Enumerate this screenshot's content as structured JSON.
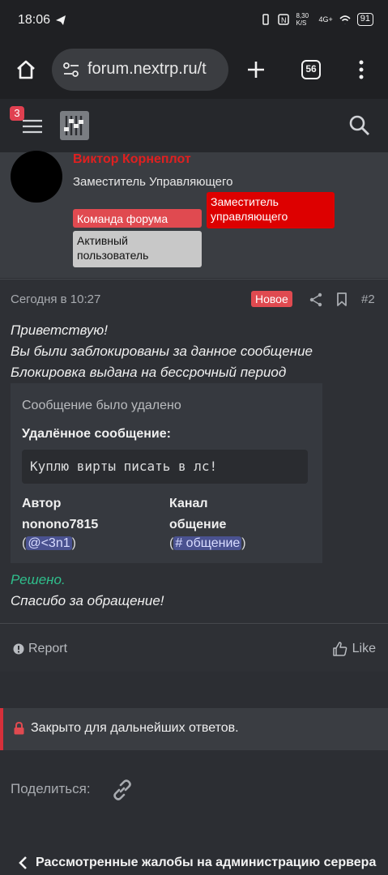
{
  "status_bar": {
    "time": "18:06",
    "net_speed": "8,30 K/S",
    "network": "4G+",
    "battery": "91"
  },
  "browser": {
    "url": "forum.nextrp.ru/t",
    "tab_count": "56"
  },
  "forum_nav": {
    "notification_count": "3"
  },
  "author": {
    "name": "Виктор Корнеплот",
    "title": "Заместитель Управляющего",
    "banners": {
      "deputy": "Заместитель управляющего",
      "team": "Команда форума",
      "active": "Активный пользователь"
    }
  },
  "post": {
    "date": "Сегодня в 10:27",
    "new_badge": "Новое",
    "number": "#2",
    "lines": [
      "Приветствую!",
      "Вы были заблокированы за данное сообщение",
      "Блокировка выдана на бессрочный период"
    ],
    "embed": {
      "title": "Сообщение было удалено",
      "subtitle": "Удалённое сообщение:",
      "code": "Куплю вирты писать в лс!",
      "author_label": "Автор",
      "author_name": "nonono7815",
      "author_mention": "@<3n1",
      "channel_label": "Канал",
      "channel_name": "общение",
      "channel_mention": "# общение"
    },
    "solved": "Решено.",
    "thanks": "Спасибо за обращение!",
    "report_label": "Report",
    "like_label": "Like"
  },
  "closed_notice": "Закрыто для дальнейших ответов.",
  "share_label": "Поделиться:",
  "back_link": "Рассмотренные жалобы на администрацию сервера"
}
